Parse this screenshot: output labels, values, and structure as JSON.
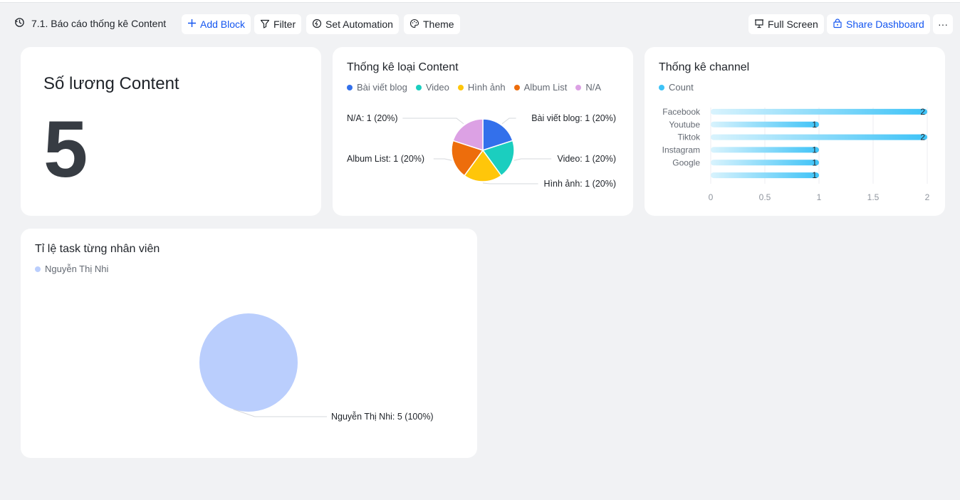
{
  "toolbar": {
    "title": "7.1. Báo cáo thống kê Content",
    "add_block": "Add Block",
    "filter": "Filter",
    "set_automation": "Set Automation",
    "theme": "Theme",
    "full_screen": "Full Screen",
    "share_dashboard": "Share Dashboard",
    "more": "···"
  },
  "metric_card": {
    "title": "Số lương Content",
    "value": "5"
  },
  "content_type_card": {
    "title": "Thống kê loại Content",
    "chart_data": {
      "type": "pie",
      "title": "Thống kê loại Content",
      "categories": [
        "Bài viết blog",
        "Video",
        "Hình ảnh",
        "Album List",
        "N/A"
      ],
      "values": [
        1,
        1,
        1,
        1,
        1
      ],
      "percents": [
        "20%",
        "20%",
        "20%",
        "20%",
        "20%"
      ],
      "colors": [
        "#3370eb",
        "#1bcebf",
        "#ffc60a",
        "#ed6d0c",
        "#dca1e4"
      ],
      "slice_labels": [
        "Bài viết blog: 1 (20%)",
        "Video: 1 (20%)",
        "Hình ảnh: 1 (20%)",
        "Album List: 1 (20%)",
        "N/A: 1 (20%)"
      ],
      "legend": "top"
    }
  },
  "channel_card": {
    "title": "Thống kê channel",
    "chart_data": {
      "type": "bar",
      "orientation": "horizontal",
      "title": "Thống kê channel",
      "categories": [
        "Facebook",
        "Youtube",
        "Tiktok",
        "Instagram",
        "Google",
        ""
      ],
      "series": [
        {
          "name": "Count",
          "values": [
            2,
            1,
            2,
            1,
            1,
            1
          ],
          "color": "#3ec3f7"
        }
      ],
      "xlim": [
        0,
        2
      ],
      "xticks": [
        "0",
        "0.5",
        "1",
        "1.5",
        "2"
      ],
      "grid": true,
      "legend": "top-left"
    }
  },
  "task_card": {
    "title": "Tỉ lệ task từng nhân viên",
    "chart_data": {
      "type": "pie",
      "title": "Tỉ lệ task từng nhân viên",
      "categories": [
        "Nguyễn Thị  Nhi"
      ],
      "values": [
        5
      ],
      "percents": [
        "100%"
      ],
      "colors": [
        "#bacefd"
      ],
      "slice_labels": [
        "Nguyễn Thị  Nhi: 5 (100%)"
      ],
      "legend": "top-left"
    }
  }
}
